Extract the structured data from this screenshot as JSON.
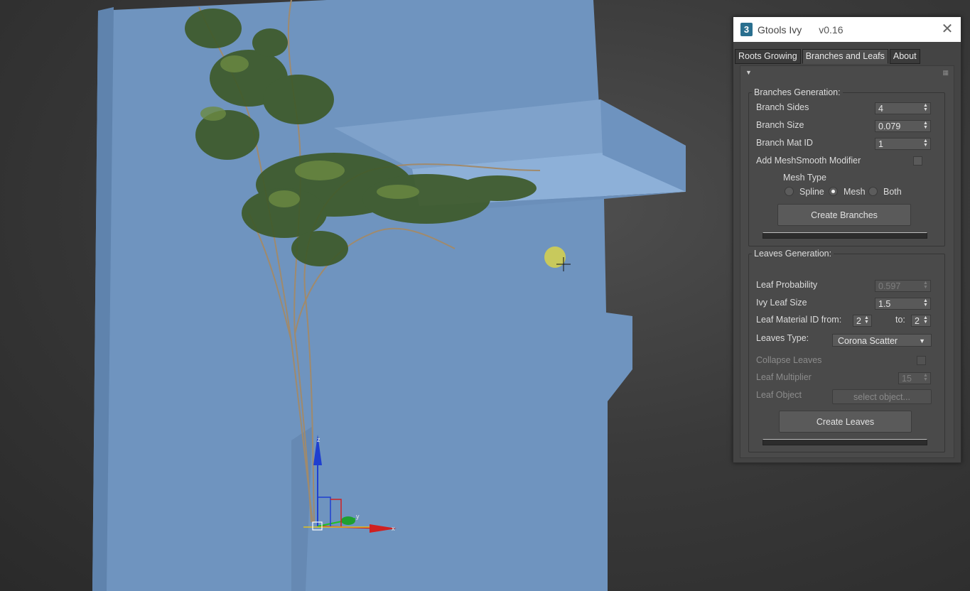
{
  "window": {
    "title": "Gtools Ivy",
    "version": "v0.16",
    "app_icon_text": "3"
  },
  "tabs": [
    {
      "label": "Roots Growing"
    },
    {
      "label": "Branches and Leafs"
    },
    {
      "label": "About"
    }
  ],
  "branches": {
    "group_title": "Branches Generation:",
    "sides_label": "Branch Sides",
    "sides_value": "4",
    "size_label": "Branch Size",
    "size_value": "0.079",
    "mat_id_label": "Branch Mat ID",
    "mat_id_value": "1",
    "meshsmooth_label": "Add MeshSmooth Modifier",
    "meshsmooth_checked": false,
    "mesh_type_label": "Mesh Type",
    "mesh_type_options": [
      "Spline",
      "Mesh",
      "Both"
    ],
    "mesh_type_selected": "Mesh",
    "create_button": "Create Branches"
  },
  "leaves": {
    "group_title": "Leaves Generation:",
    "probability_label": "Leaf Probability",
    "probability_value": "0.597",
    "size_label": "Ivy Leaf Size",
    "size_value": "1.5",
    "mat_from_label": "Leaf Material ID from:",
    "mat_from_value": "2",
    "mat_to_label": "to:",
    "mat_to_value": "2",
    "type_label": "Leaves Type:",
    "type_value": "Corona Scatter",
    "collapse_label": "Collapse Leaves",
    "multiplier_label": "Leaf Multiplier",
    "multiplier_value": "15",
    "object_label": "Leaf Object",
    "object_button": "select object...",
    "create_button": "Create Leaves"
  },
  "viewport": {
    "gizmo_axes": [
      "x",
      "y",
      "z"
    ],
    "wall_color": "#6f95c0",
    "cursor": "crosshair-cursor"
  }
}
